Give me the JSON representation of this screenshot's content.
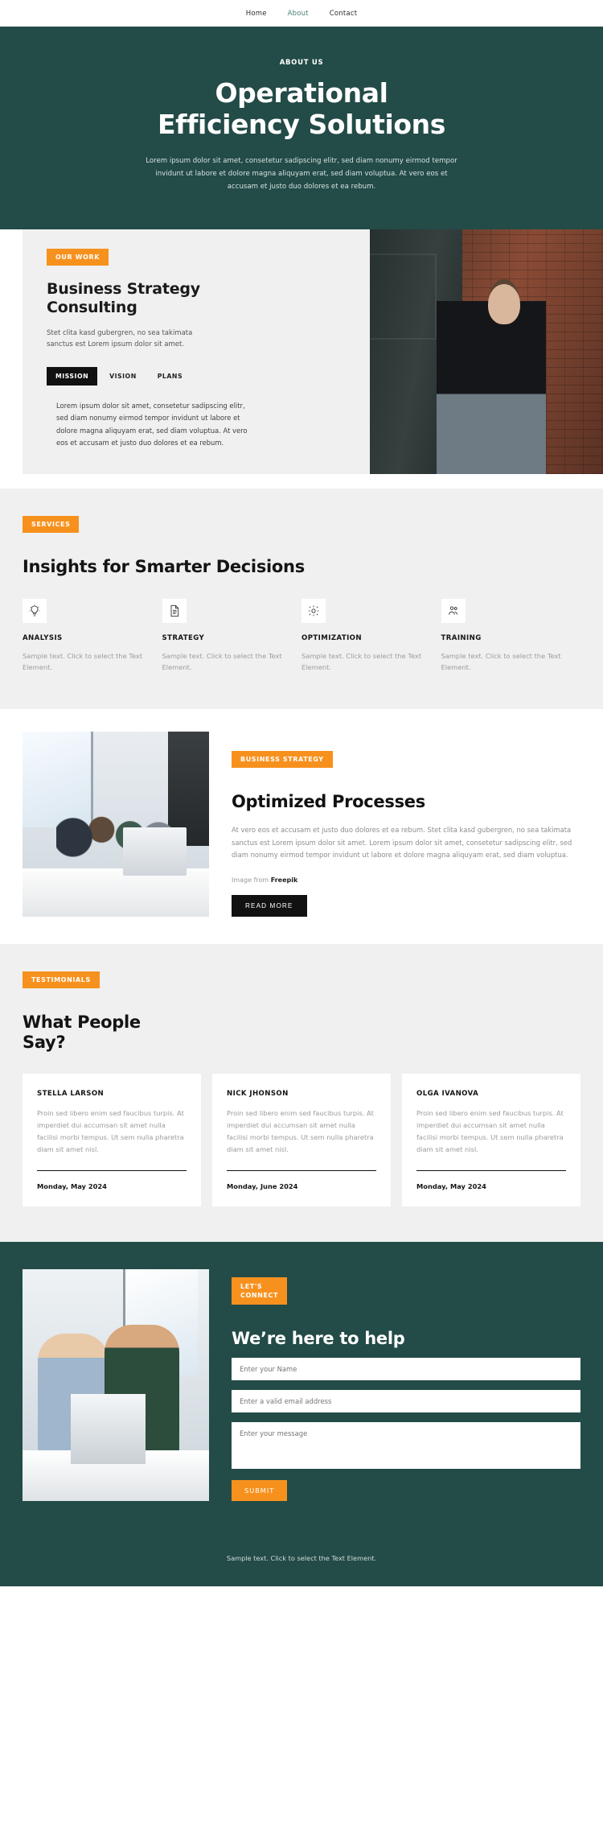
{
  "nav": {
    "items": [
      {
        "label": "Home",
        "active": false
      },
      {
        "label": "About",
        "active": true
      },
      {
        "label": "Contact",
        "active": false
      }
    ]
  },
  "hero": {
    "eyebrow": "ABOUT US",
    "title_line1": "Operational",
    "title_line2": "Efficiency Solutions",
    "paragraph": "Lorem ipsum dolor sit amet, consetetur sadipscing elitr, sed diam nonumy eirmod tempor invidunt ut labore et dolore magna aliquyam erat, sed diam voluptua. At vero eos et accusam et justo duo dolores et ea rebum."
  },
  "work": {
    "badge": "OUR WORK",
    "title_line1": "Business Strategy",
    "title_line2": "Consulting",
    "lead": "Stet clita kasd gubergren, no sea takimata sanctus est Lorem ipsum dolor sit amet.",
    "tabs": [
      {
        "label": "MISSION",
        "active": true
      },
      {
        "label": "VISION",
        "active": false
      },
      {
        "label": "PLANS",
        "active": false
      }
    ],
    "tab_body": "Lorem ipsum dolor sit amet, consetetur sadipscing elitr, sed diam nonumy eirmod tempor invidunt ut labore et dolore magna aliquyam erat, sed diam voluptua. At vero eos et accusam et justo duo dolores et ea rebum.",
    "photo_alt": "businesswoman-portrait-photo"
  },
  "services": {
    "badge": "SERVICES",
    "title": "Insights for Smarter Decisions",
    "items": [
      {
        "icon": "lightbulb-icon",
        "name": "ANALYSIS",
        "text": "Sample text. Click to select the Text Element."
      },
      {
        "icon": "checklist-document-icon",
        "name": "STRATEGY",
        "text": "Sample text. Click to select the Text Element."
      },
      {
        "icon": "gear-icon",
        "name": "OPTIMIZATION",
        "text": "Sample text. Click to select the Text Element."
      },
      {
        "icon": "people-icon",
        "name": "TRAINING",
        "text": "Sample text. Click to select the Text Element."
      }
    ]
  },
  "process": {
    "badge": "BUSINESS STRATEGY",
    "title": "Optimized Processes",
    "text": "At vero eos et accusam et justo duo dolores et ea rebum. Stet clita kasd gubergren, no sea takimata sanctus est Lorem ipsum dolor sit amet. Lorem ipsum dolor sit amet, consetetur sadipscing elitr, sed diam nonumy eirmod tempor invidunt ut labore et dolore magna aliquyam erat, sed diam voluptua.",
    "credit_prefix": "Image from ",
    "credit_source": "Freepik",
    "button": "READ MORE",
    "photo_alt": "team-meeting-office-photo"
  },
  "testimonials": {
    "badge": "TESTIMONIALS",
    "title_line1": "What People",
    "title_line2": "Say?",
    "cards": [
      {
        "name": "STELLA LARSON",
        "quote": "Proin sed libero enim sed faucibus turpis. At imperdiet dui accumsan sit amet nulla facilisi morbi tempus. Ut sem nulla pharetra diam sit amet nisl.",
        "date": "Monday, May 2024"
      },
      {
        "name": "NICK JHONSON",
        "quote": "Proin sed libero enim sed faucibus turpis. At imperdiet dui accumsan sit amet nulla facilisi morbi tempus. Ut sem nulla pharetra diam sit amet nisl.",
        "date": "Monday, June 2024"
      },
      {
        "name": "OLGA IVANOVA",
        "quote": "Proin sed libero enim sed faucibus turpis. At imperdiet dui accumsan sit amet nulla facilisi morbi tempus. Ut sem nulla pharetra diam sit amet nisl.",
        "date": "Monday, May 2024"
      }
    ]
  },
  "contact": {
    "badge_line1": "LET'S",
    "badge_line2": "CONNECT",
    "title": "We’re here to help",
    "name_placeholder": "Enter your Name",
    "email_placeholder": "Enter a valid email address",
    "message_placeholder": "Enter your message",
    "submit": "SUBMIT",
    "photo_alt": "two-colleagues-at-desk-photo"
  },
  "footer": {
    "text": "Sample text. Click to select the Text Element."
  },
  "colors": {
    "dark_green": "#234b47",
    "orange": "#f7911e",
    "light_gray": "#f0f0f0",
    "black": "#111111"
  }
}
